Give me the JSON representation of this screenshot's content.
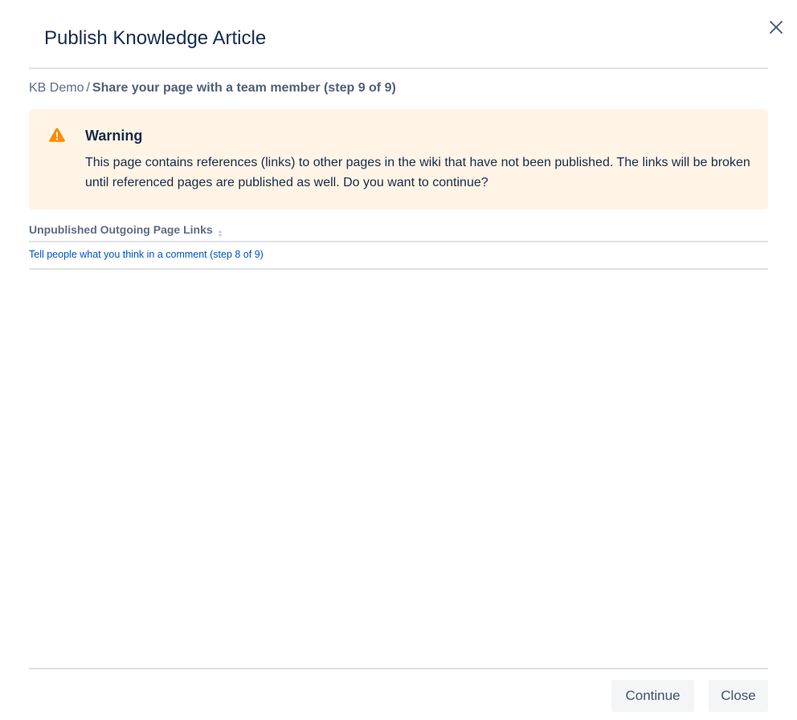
{
  "dialog": {
    "title": "Publish Knowledge Article",
    "close_icon": "close-icon"
  },
  "breadcrumb": {
    "root": "KB Demo",
    "separator": "/",
    "current": "Share your page with a team member (step 9 of 9)"
  },
  "warning": {
    "icon": "warning-triangle-icon",
    "color": "#ff8b00",
    "background": "#fff4e5",
    "title": "Warning",
    "message": "This page contains references (links) to other pages in the wiki that have not been published. The links will be broken until referenced pages are published as well. Do you want to continue?"
  },
  "table": {
    "column_header": "Unpublished Outgoing Page Links",
    "rows": [
      {
        "link": "Tell people what you think in a comment (step 8 of 9)"
      }
    ]
  },
  "footer": {
    "continue_label": "Continue",
    "close_label": "Close"
  }
}
